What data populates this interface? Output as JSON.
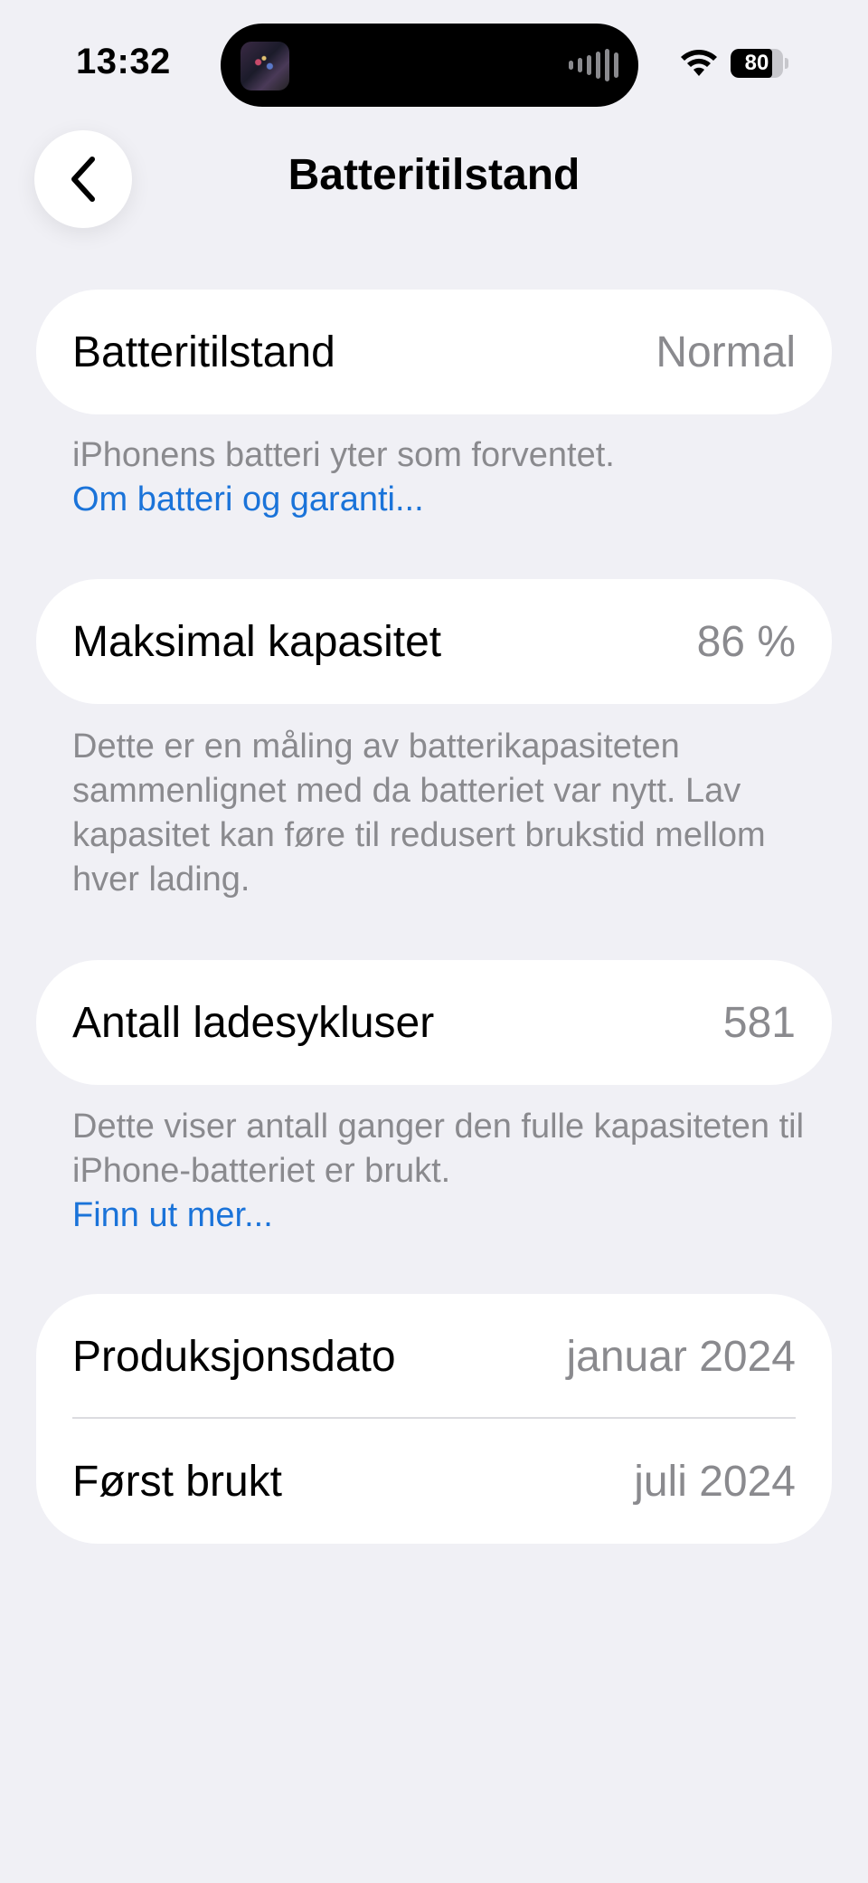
{
  "status_bar": {
    "time": "13:32",
    "battery_level": "80",
    "battery_fraction": 0.8
  },
  "nav": {
    "title": "Batteritilstand",
    "back_icon": "chevron-left-icon"
  },
  "sections": {
    "health": {
      "label": "Batteritilstand",
      "value": "Normal",
      "footnote": "iPhonens batteri yter som forventet.",
      "link": "Om batteri og garanti..."
    },
    "capacity": {
      "label": "Maksimal kapasitet",
      "value": "86 %",
      "footnote": "Dette er en måling av batterikapasiteten sammenlignet med da batteriet var nytt. Lav kapasitet kan føre til redusert brukstid mellom hver lading."
    },
    "cycles": {
      "label": "Antall ladesykluser",
      "value": "581",
      "footnote": "Dette viser antall ganger den fulle kapasiteten til iPhone-batteriet er brukt.",
      "link": "Finn ut mer..."
    },
    "dates": {
      "manufacture_label": "Produksjonsdato",
      "manufacture_value": "januar 2024",
      "first_use_label": "Først brukt",
      "first_use_value": "juli 2024"
    }
  },
  "colors": {
    "background": "#f0f0f5",
    "card": "#ffffff",
    "secondary_text": "#8a8a8e",
    "link": "#1a73d9"
  }
}
